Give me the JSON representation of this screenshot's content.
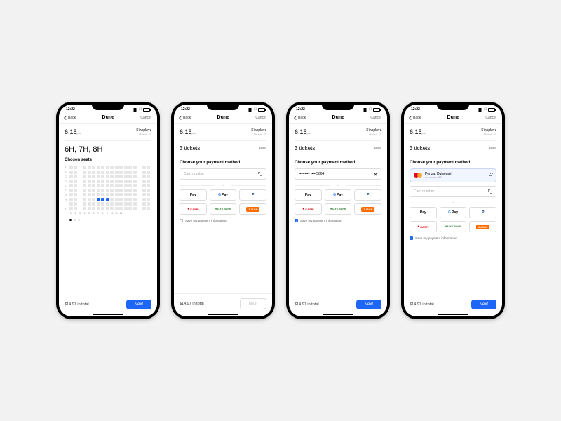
{
  "status": {
    "time": "12:22"
  },
  "nav": {
    "back": "Back",
    "title": "Dune",
    "cancel": "Cancel"
  },
  "showtime": {
    "time": "6:15",
    "ampm": "pm",
    "venue": "Kinoplexx",
    "date": "16 dist. 23"
  },
  "tickets": {
    "count": "3 tickets",
    "type": "Adult"
  },
  "seats": {
    "chosen_label": "Chosen seats",
    "chosen": "6H, 7H, 8H",
    "rows": [
      "A",
      "B",
      "C",
      "D",
      "E",
      "F",
      "G",
      "H",
      "I",
      "J"
    ],
    "cols": [
      "1",
      "2",
      "3",
      "4",
      "5",
      "6",
      "7",
      "8",
      "9",
      "10",
      "11",
      "12"
    ],
    "selected": [
      "H6",
      "H7",
      "H8"
    ]
  },
  "payment": {
    "title": "Choose your payment method",
    "card_placeholder": "Card number",
    "card_masked": "•••• •••• •••• 5664",
    "or": "or",
    "methods": {
      "applepay": "Pay",
      "gpay": "Pay",
      "paypal": "P",
      "kaspi": "KASPI",
      "halyk": "HALYK BANK",
      "jusan": "JUSAN"
    },
    "save_label": "Save my payment information",
    "saved": {
      "name": "Perizat Duisegali",
      "masked": "•••• •••• •••• 5664"
    }
  },
  "footer": {
    "total": "$14.97 in total",
    "next": "Next"
  }
}
